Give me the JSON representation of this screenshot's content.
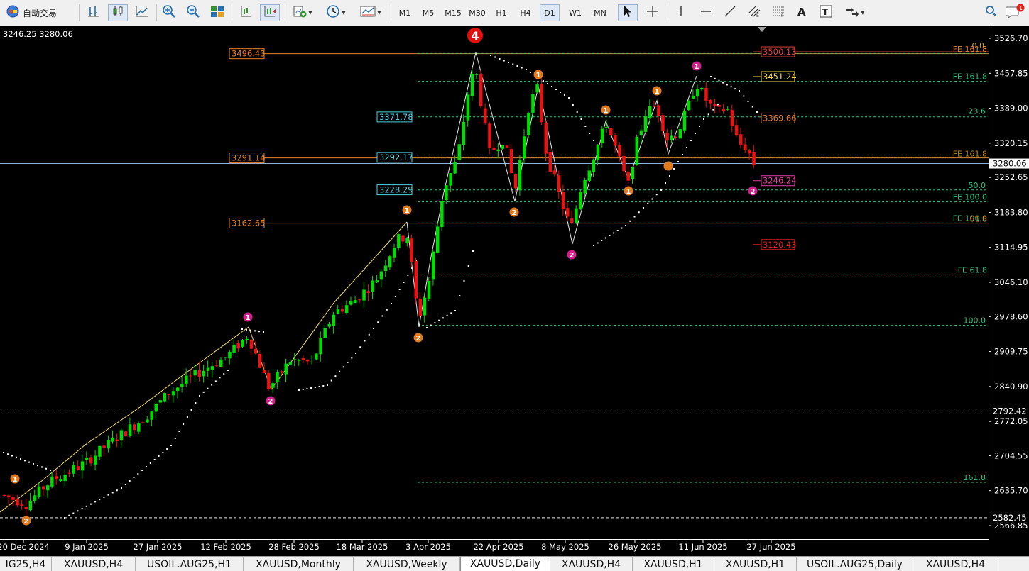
{
  "toolbar": {
    "autotrade_label": "自动交易",
    "timeframes": [
      "M1",
      "M5",
      "M15",
      "M30",
      "H1",
      "H4",
      "D1",
      "W1",
      "MN"
    ],
    "active_timeframe": "D1"
  },
  "chart": {
    "symbol": "XAUUSD",
    "timeframe": "Daily",
    "ohlc_readout": "3246.25 3280.06",
    "current_price": "3280.06",
    "price_axis": [
      "3526.70",
      "3457.85",
      "3389.00",
      "3320.15",
      "3252.65",
      "3183.80",
      "3114.95",
      "3046.10",
      "2978.60",
      "2909.75",
      "2840.90",
      "2772.05",
      "2704.55",
      "2635.70",
      "2566.85"
    ],
    "extra_price_labels": [
      "2792.42",
      "2582.45"
    ],
    "date_axis": [
      "20 Dec 2024",
      "9 Jan 2025",
      "27 Jan 2025",
      "12 Feb 2025",
      "28 Feb 2025",
      "18 Mar 2025",
      "3 Apr 2025",
      "22 Apr 2025",
      "8 May 2025",
      "26 May 2025",
      "11 Jun 2025",
      "27 Jun 2025"
    ],
    "left_level_labels": [
      "3496.43",
      "3291.14",
      "3162.65"
    ],
    "mid_level_labels": [
      "3371.78",
      "3292.17",
      "3228.29"
    ],
    "right_price_labels": [
      "3500.13",
      "3451.24",
      "3369.66",
      "3246.24",
      "3120.43"
    ],
    "fib_labels": [
      "FE 161.8",
      "23.6",
      "FE 100.0",
      "50.0",
      "FE 100.0",
      "61.8",
      "FE 61.8",
      "100.0",
      "161.8",
      "FE 161.8",
      "0.0"
    ],
    "wave_labels": [
      "1",
      "2",
      "1",
      "2",
      "1",
      "2",
      "1",
      "2",
      "1",
      "2",
      "1",
      "2",
      "1",
      "2"
    ],
    "top_wave_label": "4"
  },
  "tabs": [
    "IG25,H4",
    "XAUUSD,H4",
    "USOIL.AUG25,H1",
    "XAUUSD,Monthly",
    "XAUUSD,Weekly",
    "XAUUSD,Daily",
    "XAUUSD,H4",
    "XAUUSD,H1",
    "XAUUSD,H1",
    "USOIL.AUG25,Daily",
    "XAUUSD,H4"
  ],
  "active_tab": "XAUUSD,Daily",
  "colors": {
    "bull_candle": "#00dd00",
    "bear_candle": "#ee1111",
    "fib_line": "#2ec27e",
    "orange_level": "#e8822a",
    "cyan_level": "#4fd0e0",
    "wave_orange": "#e07a1f",
    "wave_magenta": "#d21f8c"
  }
}
